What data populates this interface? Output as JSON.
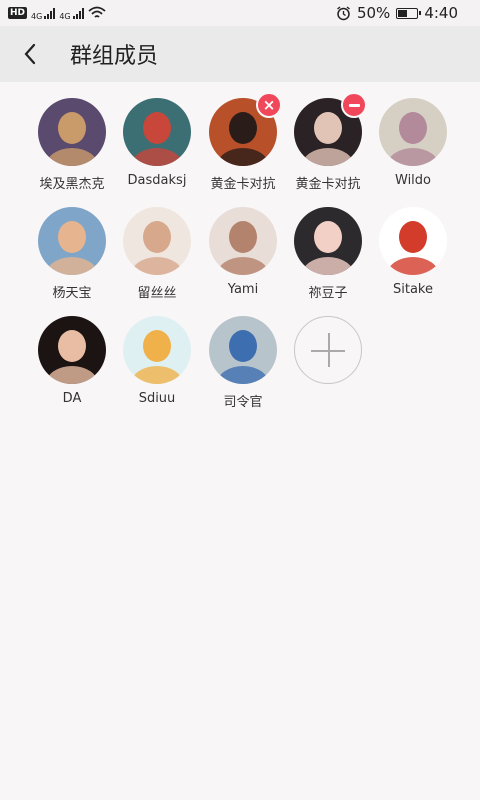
{
  "status_bar": {
    "hd": "HD",
    "net1": "4G",
    "net2": "4G",
    "battery_pct": "50%",
    "time": "4:40"
  },
  "title_bar": {
    "back_icon": "back-arrow-icon",
    "title": "群组成员"
  },
  "members": [
    {
      "name": "埃及黑杰克",
      "badge": null,
      "colors": [
        "#5a4a6e",
        "#c99a6a"
      ]
    },
    {
      "name": "Dasdaksj",
      "badge": null,
      "colors": [
        "#3b6f73",
        "#c9463b"
      ]
    },
    {
      "name": "黄金卡对抗",
      "badge": "remove-x",
      "colors": [
        "#b8502a",
        "#2a1c18"
      ]
    },
    {
      "name": "黄金卡对抗",
      "badge": "remove-minus",
      "colors": [
        "#2b2226",
        "#e2c4b7"
      ]
    },
    {
      "name": "Wildo",
      "badge": null,
      "colors": [
        "#d6d0c4",
        "#b28a9a"
      ]
    },
    {
      "name": "杨天宝",
      "badge": null,
      "colors": [
        "#7fa6c9",
        "#e6b48f"
      ]
    },
    {
      "name": "留丝丝",
      "badge": null,
      "colors": [
        "#efe6df",
        "#d8a88c"
      ]
    },
    {
      "name": "Yami",
      "badge": null,
      "colors": [
        "#e9ddd8",
        "#b4836d"
      ]
    },
    {
      "name": "祢豆子",
      "badge": null,
      "colors": [
        "#2d2a2e",
        "#f2d0c6"
      ]
    },
    {
      "name": "Sitake",
      "badge": null,
      "colors": [
        "#ffffff",
        "#d33b2a"
      ]
    },
    {
      "name": "DA",
      "badge": null,
      "colors": [
        "#1c1412",
        "#e8bda4"
      ]
    },
    {
      "name": "Sdiuu",
      "badge": null,
      "colors": [
        "#dff0f2",
        "#f0b14a"
      ]
    },
    {
      "name": "司令官",
      "badge": null,
      "colors": [
        "#b8c4cc",
        "#3d6fb0"
      ]
    }
  ],
  "add_button": {
    "icon": "plus-icon"
  }
}
